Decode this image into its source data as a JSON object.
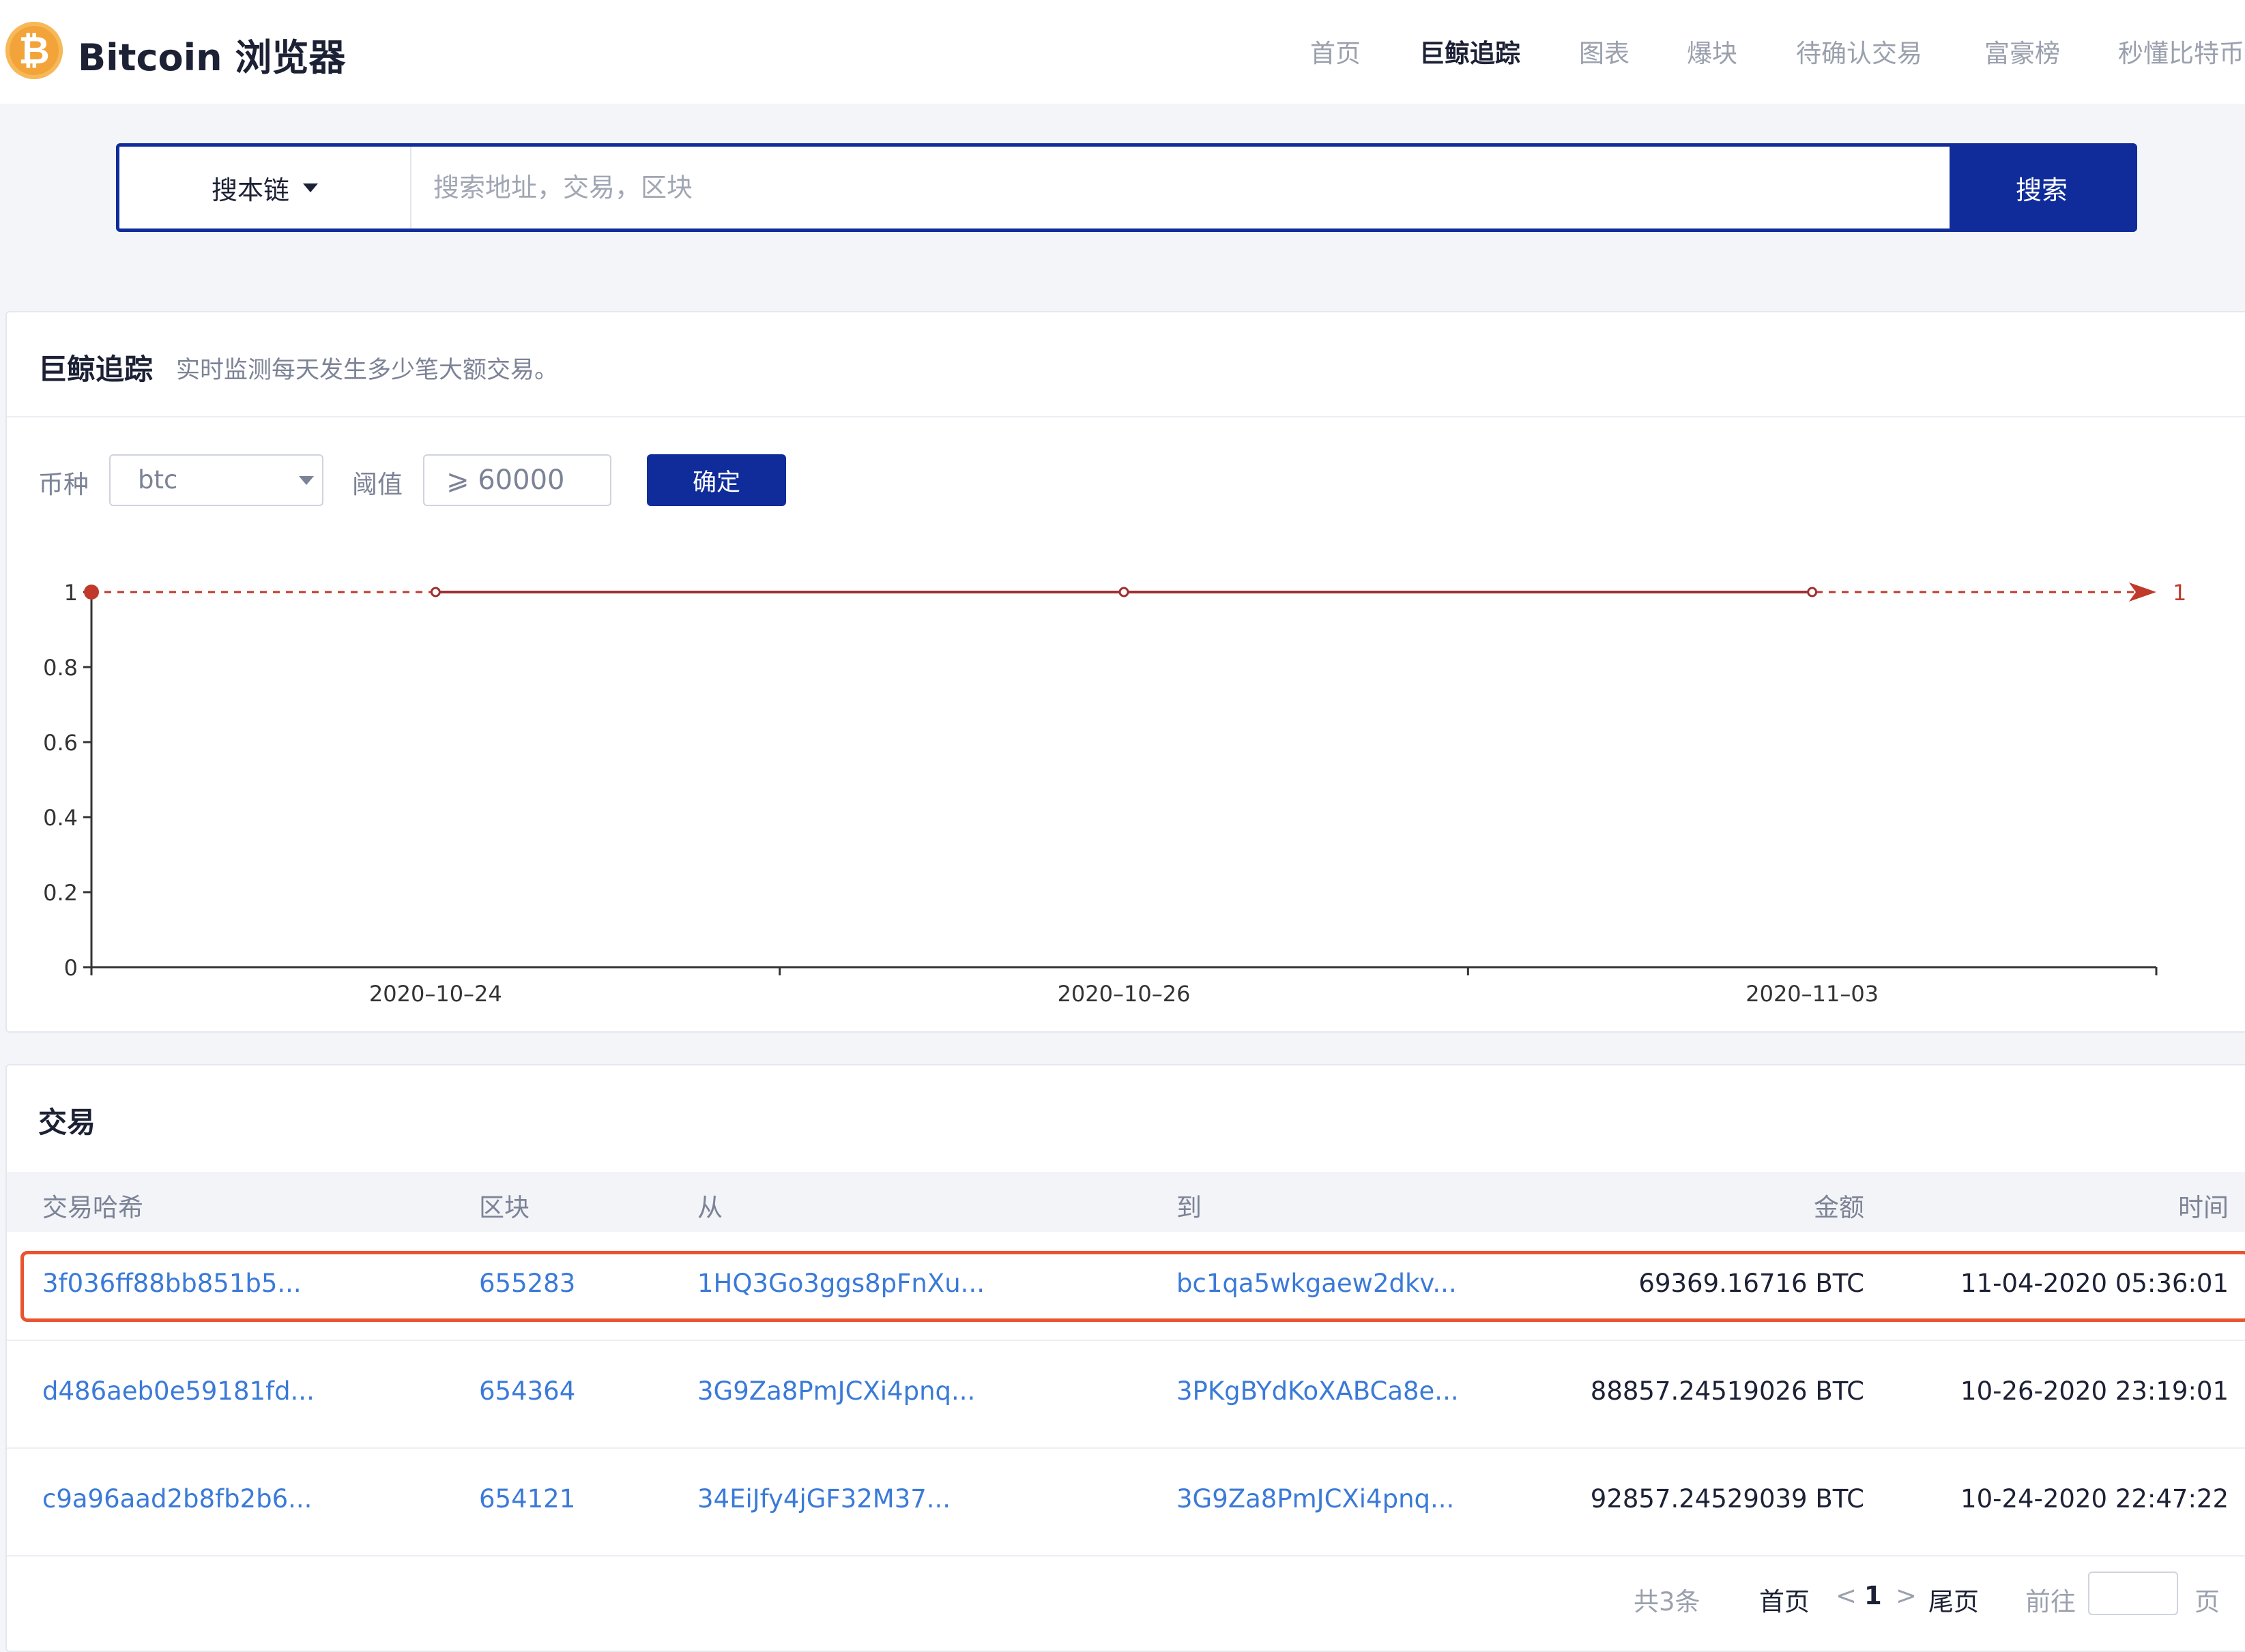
{
  "header": {
    "logo_glyph": "₿",
    "brand": "Bitcoin 浏览器",
    "nav": [
      {
        "label": "首页",
        "active": false
      },
      {
        "label": "巨鲸追踪",
        "active": true
      },
      {
        "label": "图表",
        "active": false
      },
      {
        "label": "爆块",
        "active": false
      },
      {
        "label": "待确认交易",
        "active": false
      },
      {
        "label": "富豪榜",
        "active": false
      },
      {
        "label": "秒懂比特币",
        "active": false
      }
    ]
  },
  "search": {
    "scope_label": "搜本链",
    "placeholder": "搜索地址，交易，区块",
    "button_label": "搜索"
  },
  "whale": {
    "title": "巨鲸追踪",
    "subtitle": "实时监测每天发生多少笔大额交易。",
    "currency_label": "币种",
    "currency_value": "btc",
    "threshold_label": "阈值",
    "threshold_value": "⩾  60000",
    "confirm_label": "确定"
  },
  "chart_data": {
    "type": "line",
    "x": [
      "2020-10-24",
      "2020-10-26",
      "2020-11-03"
    ],
    "series": [
      {
        "values": [
          1,
          1,
          1
        ]
      }
    ],
    "ylim": [
      0,
      1
    ],
    "y_ticks": [
      "0",
      "0.2",
      "0.4",
      "0.6",
      "0.8",
      "1"
    ],
    "x_tick_labels": [
      "2020–10–24",
      "2020–10–26",
      "2020–11–03"
    ],
    "reference_line_label": "1",
    "line_color": "#c0392b",
    "grid": false
  },
  "transactions": {
    "title": "交易",
    "columns": [
      "交易哈希",
      "区块",
      "从",
      "到",
      "金额",
      "时间"
    ],
    "rows": [
      {
        "hash": "3f036ff88bb851b5...",
        "block": "655283",
        "from": "1HQ3Go3ggs8pFnXu...",
        "to": "bc1qa5wkgaew2dkv...",
        "amount": "69369.16716 BTC",
        "time": "11-04-2020 05:36:01"
      },
      {
        "hash": "d486aeb0e59181fd...",
        "block": "654364",
        "from": "3G9Za8PmJCXi4pnq...",
        "to": "3PKgBYdKoXABCa8e...",
        "amount": "88857.24519026 BTC",
        "time": "10-26-2020 23:19:01"
      },
      {
        "hash": "c9a96aad2b8fb2b6...",
        "block": "654121",
        "from": "34EiJfy4jGF32M37...",
        "to": "3G9Za8PmJCXi4pnq...",
        "amount": "92857.24529039 BTC",
        "time": "10-24-2020 22:47:22"
      }
    ]
  },
  "pagination": {
    "total": "共3条",
    "first": "首页",
    "prev": "<",
    "current": "1",
    "next": ">",
    "last": "尾页",
    "goto": "前往",
    "page_unit": "页"
  },
  "colors": {
    "primary": "#0f2c9a",
    "link": "#3a7ad8",
    "highlight": "#e8542f"
  }
}
